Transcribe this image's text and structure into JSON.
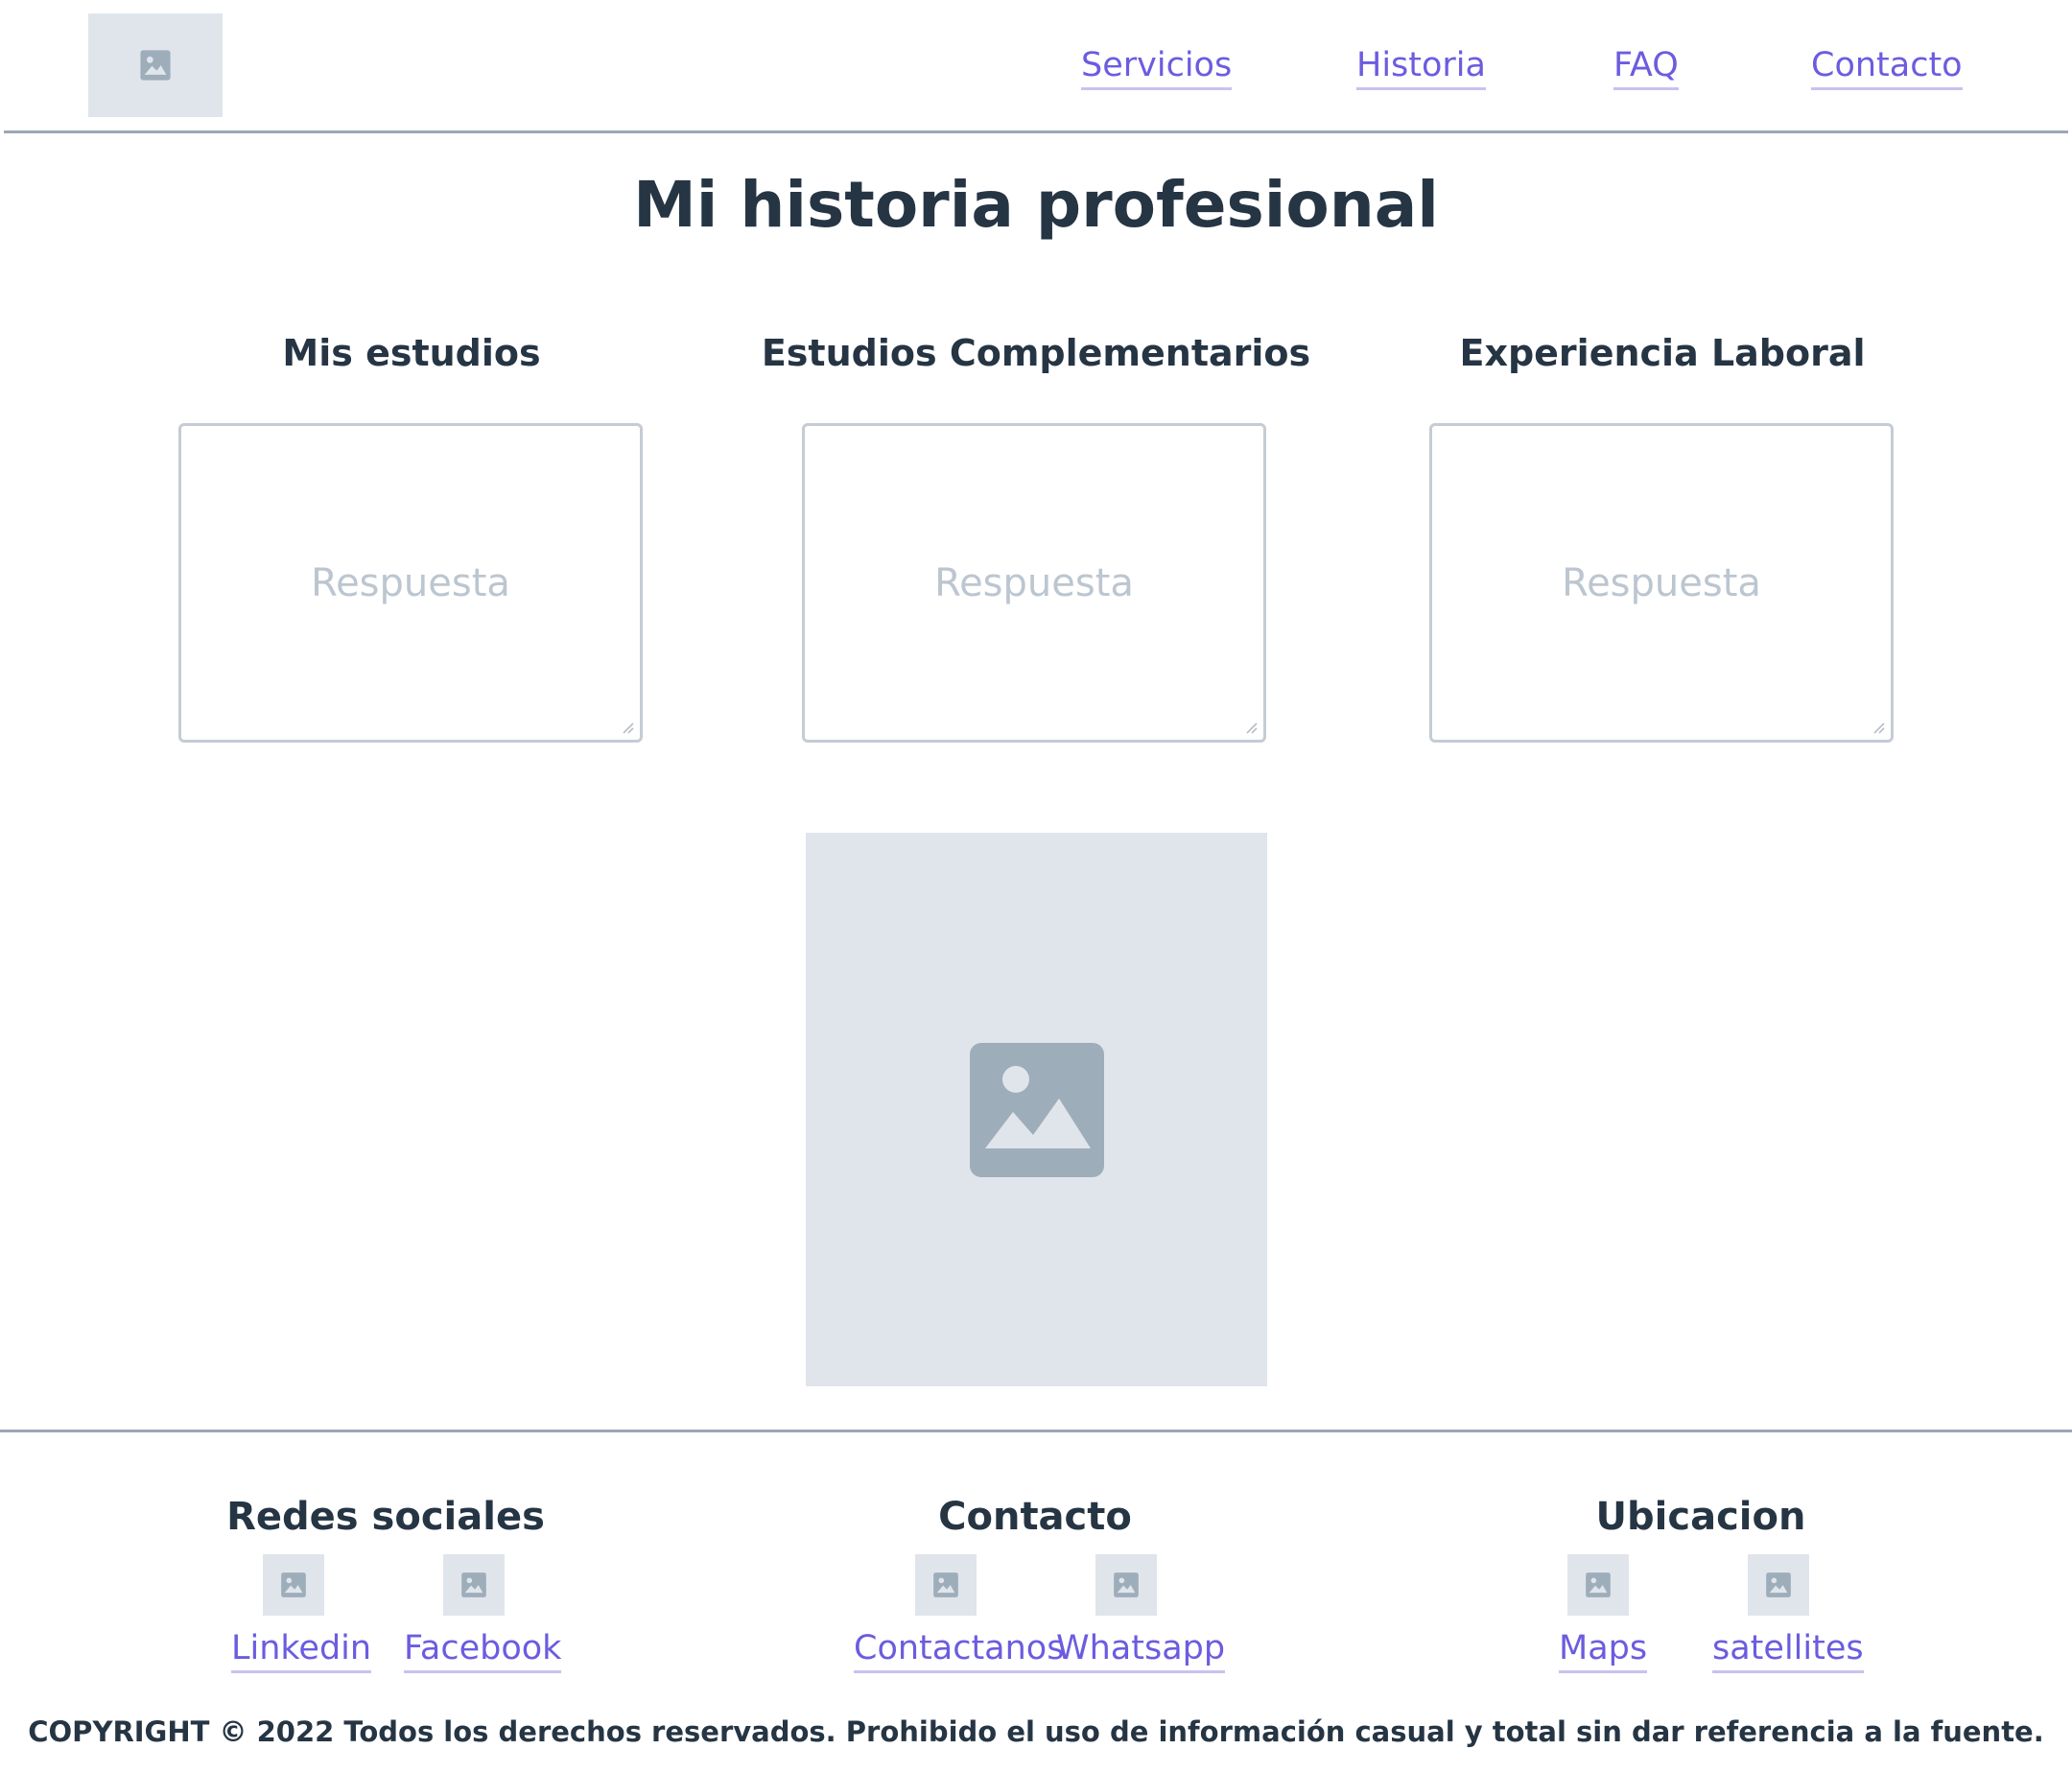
{
  "header": {
    "logo_icon": "image-placeholder-icon",
    "nav": [
      {
        "label": "Servicios"
      },
      {
        "label": "Historia"
      },
      {
        "label": "FAQ"
      },
      {
        "label": "Contacto"
      }
    ]
  },
  "main": {
    "title": "Mi historia profesional",
    "columns": [
      {
        "title": "Mis estudios",
        "placeholder": "Respuesta"
      },
      {
        "title": "Estudios Complementarios",
        "placeholder": "Respuesta"
      },
      {
        "title": "Experiencia Laboral",
        "placeholder": "Respuesta"
      }
    ],
    "image_icon": "image-placeholder-icon"
  },
  "footer": {
    "groups": [
      {
        "title": "Redes sociales",
        "links": [
          {
            "label": "Linkedin"
          },
          {
            "label": "Facebook"
          }
        ]
      },
      {
        "title": "Contacto",
        "links": [
          {
            "label": "Contactanos"
          },
          {
            "label": "Whatsapp"
          }
        ]
      },
      {
        "title": "Ubicacion",
        "links": [
          {
            "label": "Maps"
          },
          {
            "label": "satellites"
          }
        ]
      }
    ],
    "copyright": "COPYRIGHT © 2022 Todos los derechos reservados. Prohibido el uso de información casual y total sin dar referencia a la fuente."
  },
  "colors": {
    "text": "#263544",
    "link": "#6b5ce0",
    "link_underline": "#c7c2f0",
    "placeholder_bg": "#e0e5ec",
    "placeholder_icon": "#9eadba",
    "rule": "#9aa7b5",
    "answer_border": "#c5ccd5",
    "answer_placeholder": "#bcc6d0"
  }
}
